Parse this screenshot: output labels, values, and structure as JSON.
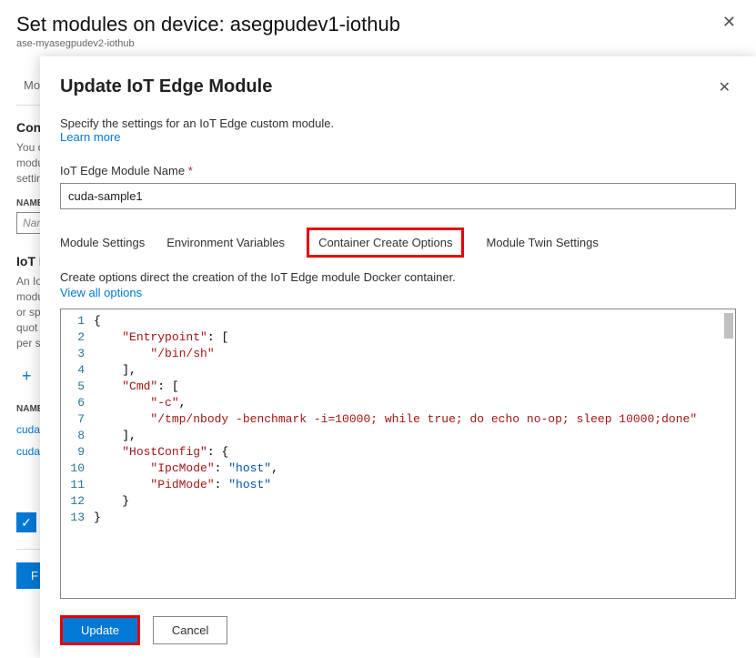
{
  "main": {
    "title": "Set modules on device: asegpudev1-iothub",
    "subtitle": "ase-myasegpudev2-iothub",
    "tab": "Mo",
    "section1": "Cont",
    "info": "You c\nmodu\nsettin",
    "colName": "NAME",
    "namePlaceholder": "Nam",
    "section2": "IoT E",
    "info2": "An Io\nmodu\nor sp\nquot\nper s",
    "item1": "cuda-",
    "item2": "cuda-"
  },
  "panel": {
    "title": "Update IoT Edge Module",
    "desc": "Specify the settings for an IoT Edge custom module.",
    "learn": "Learn more",
    "fieldLabel": "IoT Edge Module Name",
    "fieldValue": "cuda-sample1",
    "tabs": {
      "settings": "Module Settings",
      "env": "Environment Variables",
      "create": "Container Create Options",
      "twin": "Module Twin Settings"
    },
    "tabDesc": "Create options direct the creation of the IoT Edge module Docker container.",
    "viewAll": "View all options",
    "code": {
      "lines": [
        "1",
        "2",
        "3",
        "4",
        "5",
        "6",
        "7",
        "8",
        "9",
        "10",
        "11",
        "12",
        "13"
      ],
      "l1_brace": "{",
      "l2_key": "\"Entrypoint\"",
      "l2_after": ": [",
      "l3_val": "\"/bin/sh\"",
      "l4": "],",
      "l5_key": "\"Cmd\"",
      "l5_after": ": [",
      "l6_val": "\"-c\"",
      "l6_comma": ",",
      "l7_val": "\"/tmp/nbody -benchmark -i=10000; while true; do echo no-op; sleep 10000;done\"",
      "l8": "],",
      "l9_key": "\"HostConfig\"",
      "l9_after": ": {",
      "l10_key": "\"IpcMode\"",
      "l10_colon": ": ",
      "l10_val": "\"host\"",
      "l10_comma": ",",
      "l11_key": "\"PidMode\"",
      "l11_colon": ": ",
      "l11_val": "\"host\"",
      "l12": "}",
      "l13": "}"
    },
    "buttons": {
      "update": "Update",
      "cancel": "Cancel"
    }
  }
}
